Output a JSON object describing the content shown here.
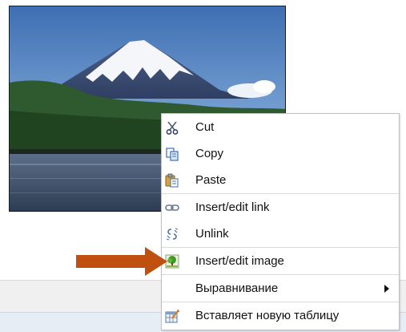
{
  "context_menu": {
    "items": [
      {
        "label": "Cut",
        "icon": "scissors-icon"
      },
      {
        "label": "Copy",
        "icon": "copy-icon"
      },
      {
        "label": "Paste",
        "icon": "paste-icon"
      },
      {
        "label": "Insert/edit link",
        "icon": "link-icon"
      },
      {
        "label": "Unlink",
        "icon": "unlink-icon"
      },
      {
        "label": "Insert/edit image",
        "icon": "image-icon"
      },
      {
        "label": "Выравнивание",
        "icon": "",
        "has_submenu": true
      },
      {
        "label": "Вставляет новую таблицу",
        "icon": "table-icon"
      }
    ]
  },
  "colors": {
    "arrow": "#c0500f",
    "menu_border": "#bfbfbf",
    "toolbar_bg": "#f0f0f0",
    "statusbar_bg": "#e6edf5"
  }
}
